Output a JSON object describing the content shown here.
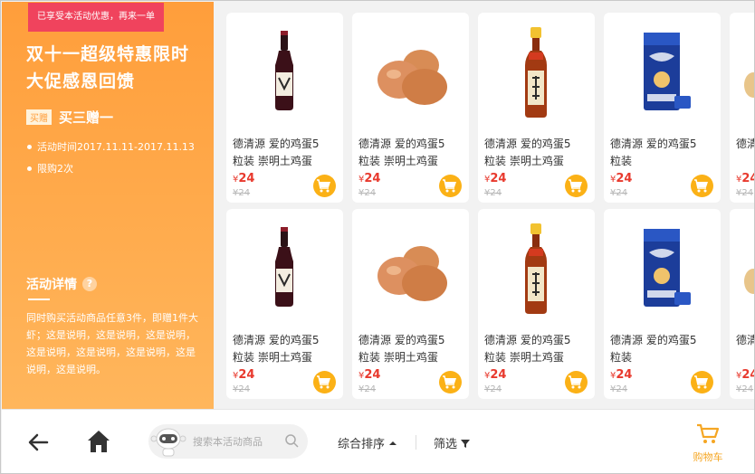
{
  "promo": {
    "top_badge": "已享受本活动优惠，再来一单",
    "title_line1": "双十一超级特惠限时",
    "title_line2": "大促感恩回馈",
    "tag": "买赠",
    "tag_text": "买三赠一",
    "time": "活动时间2017.11.11-2017.11.13",
    "limit": "限购2次",
    "details_title": "活动详情",
    "details_help": "?",
    "details_text": "同时购买活动商品任意3件，即赠1件大虾；这是说明，这是说明，这是说明，这是说明，这是说明，这是说明，这是说明，这是说明。"
  },
  "products": [
    {
      "name_line1": "德清源 爱的鸡蛋5",
      "name_line2": "粒装 崇明土鸡蛋",
      "currency": "¥",
      "price": "24",
      "old_price": "¥24",
      "image": "wine-bottle"
    },
    {
      "name_line1": "德清源 爱的鸡蛋5",
      "name_line2": "粒装 崇明土鸡蛋",
      "currency": "¥",
      "price": "24",
      "old_price": "¥24",
      "image": "eggs"
    },
    {
      "name_line1": "德清源 爱的鸡蛋5",
      "name_line2": "粒装 崇明土鸡蛋",
      "currency": "¥",
      "price": "24",
      "old_price": "¥24",
      "image": "cooking-wine-bottle"
    },
    {
      "name_line1": "德清源 爱的鸡蛋5",
      "name_line2": "粒装",
      "currency": "¥",
      "price": "24",
      "old_price": "¥24",
      "image": "tissue-pack"
    },
    {
      "name_line1": "德清",
      "name_line2": "",
      "currency": "¥",
      "price": "24",
      "old_price": "¥24",
      "image": "partial"
    },
    {
      "name_line1": "德清源 爱的鸡蛋5",
      "name_line2": "粒装 崇明土鸡蛋",
      "currency": "¥",
      "price": "24",
      "old_price": "¥24",
      "image": "wine-bottle"
    },
    {
      "name_line1": "德清源 爱的鸡蛋5",
      "name_line2": "粒装 崇明土鸡蛋",
      "currency": "¥",
      "price": "24",
      "old_price": "¥24",
      "image": "eggs"
    },
    {
      "name_line1": "德清源 爱的鸡蛋5",
      "name_line2": "粒装 崇明土鸡蛋",
      "currency": "¥",
      "price": "24",
      "old_price": "¥24",
      "image": "cooking-wine-bottle"
    },
    {
      "name_line1": "德清源 爱的鸡蛋5",
      "name_line2": "粒装",
      "currency": "¥",
      "price": "24",
      "old_price": "¥24",
      "image": "tissue-pack"
    },
    {
      "name_line1": "德清",
      "name_line2": "",
      "currency": "¥",
      "price": "24",
      "old_price": "¥24",
      "image": "partial"
    }
  ],
  "bottombar": {
    "search_placeholder": "搜索本活动商品",
    "sort_label": "综合排序",
    "filter_label": "筛选",
    "cart_label": "购物车"
  },
  "colors": {
    "accent": "#ffa24a",
    "price": "#e8392d",
    "cart": "#f5a623",
    "badge": "#f0435d"
  }
}
